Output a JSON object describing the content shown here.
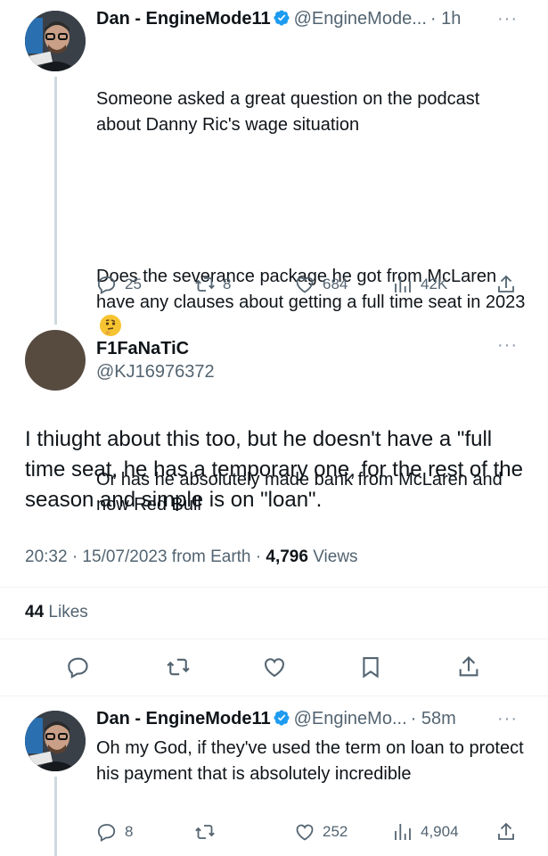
{
  "tweet1": {
    "name": "Dan - EngineMode11",
    "handle": "@EngineMode...",
    "time": "· 1h",
    "text_p1": "Someone asked a great question on the podcast about Danny Ric's wage situation",
    "text_p2": "Does the severance package he got from McLaren have any clauses about getting a full time seat in 2023",
    "text_p3": "Or has he absolutely made bank from McLaren and now Red Bull",
    "replies": "25",
    "retweets": "8",
    "likes": "684",
    "views": "42K",
    "emoji": "thinking-face"
  },
  "focus": {
    "name": "F1FaNaTiC",
    "handle": "@KJ16976372",
    "text": "I thiught about this too, but he doesn't have a \"full time seat, he has a temporary one, for the rest of the season and simple is on \"loan\".",
    "time": "20:32 · 15/07/2023 from Earth · ",
    "views_count": "4,796",
    "views_label": " Views",
    "likes_count": "44",
    "likes_label": " Likes"
  },
  "tweet3": {
    "name": "Dan - EngineMode11",
    "handle": "@EngineMo...",
    "time": "· 58m",
    "text": "Oh my God, if they've used the term on loan to protect his payment that is absolutely incredible",
    "replies": "8",
    "likes": "252",
    "views": "4,904"
  },
  "more_label": "···",
  "colors": {
    "text": "#0f1419",
    "muted": "#536471",
    "verified": "#1d9bf0",
    "line": "#cfd9de"
  }
}
